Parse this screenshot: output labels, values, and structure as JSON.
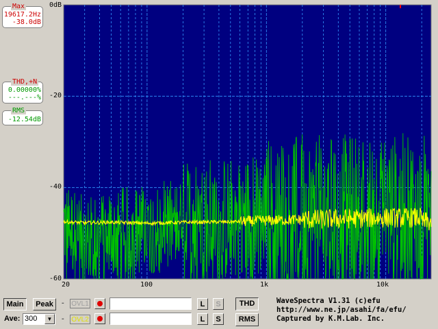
{
  "panels": {
    "max": {
      "title": "Max",
      "line1": "19617.2Hz",
      "line2": "-38.0dB"
    },
    "thd": {
      "title": "THD,+N",
      "line1": "0.00000%",
      "line2": "---.---%"
    },
    "rms": {
      "title": "RMS",
      "line1": "-12.54dB"
    }
  },
  "colors": {
    "plot_bg": "#000080",
    "grid": "#3399ff",
    "ch1": "#ffff00",
    "ch2": "#00c000",
    "red": "#cc0000",
    "green": "#009900"
  },
  "plot": {
    "y_ticks": [
      "0dB",
      "-20",
      "-40",
      "-60"
    ],
    "x_ticks": [
      "20",
      "100",
      "1k",
      "10k"
    ]
  },
  "chart_data": {
    "type": "line",
    "x_scale": "log",
    "xlim": [
      20,
      24000
    ],
    "ylim": [
      -60,
      0
    ],
    "ylabel": "",
    "xlabel": "",
    "grid": true,
    "series": [
      {
        "color": "#ffff00",
        "x": [
          20,
          30,
          50,
          100,
          200,
          500,
          1000,
          2000,
          5000,
          10000,
          20000
        ],
        "y": [
          -47.5,
          -47.7,
          -47.6,
          -47.8,
          -47.6,
          -47.5,
          -47.2,
          -47.0,
          -46.8,
          -46.6,
          -46.6
        ]
      },
      {
        "color": "#00c000",
        "x": [
          20,
          30,
          50,
          100,
          200,
          500,
          1000,
          2000,
          5000,
          10000,
          20000
        ],
        "y": [
          -48,
          -52,
          -50,
          -49,
          -48,
          -47,
          -46,
          -46,
          -46,
          -46,
          -46
        ]
      }
    ]
  },
  "controls": {
    "main_label": "Main",
    "peak_label": "Peak",
    "ave_label": "Ave:",
    "ave_value": "300",
    "ovl1_label": "OVL1",
    "ovl2_label": "OVL2",
    "dash": "-",
    "l_label": "L",
    "s_label": "S",
    "thd_label": "THD",
    "rms_label": "RMS"
  },
  "credits": {
    "line1": "WaveSpectra V1.31 (c)efu",
    "line2": "http://www.ne.jp/asahi/fa/efu/",
    "line3": "Captured by K.M.Lab. Inc."
  }
}
